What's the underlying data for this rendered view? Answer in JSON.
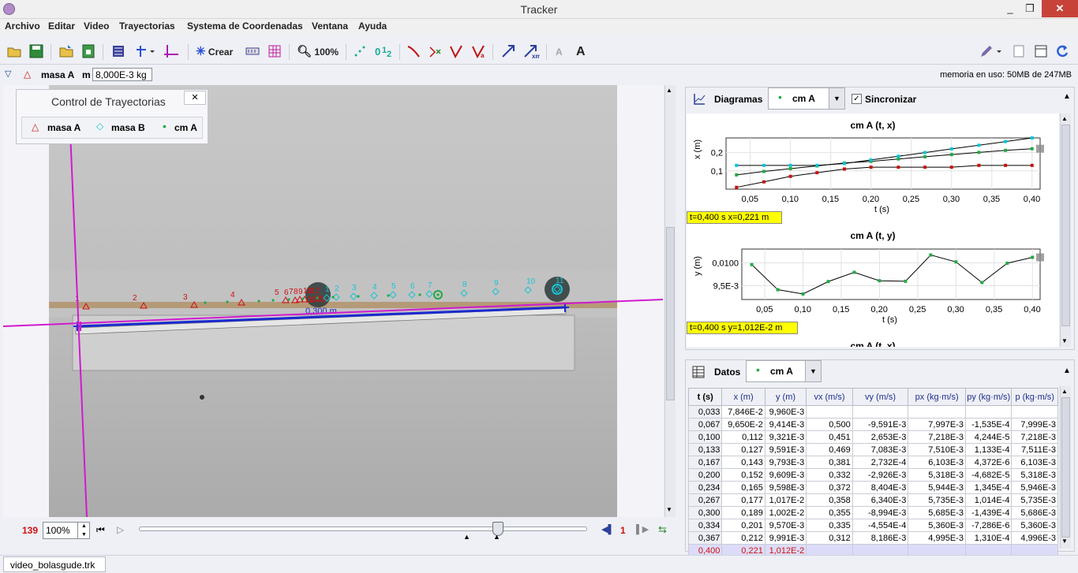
{
  "window": {
    "title": "Tracker",
    "minimize": "_",
    "restore": "❐",
    "close": "✕"
  },
  "menu": [
    "Archivo",
    "Editar",
    "Video",
    "Trayectorias",
    "Systema de Coordenadas",
    "Ventana",
    "Ayuda"
  ],
  "toolbar": {
    "create_label": "Crear",
    "zoom_label": "100%",
    "font_small": "A",
    "font_large": "A"
  },
  "trackbar": {
    "track_name": "masa A",
    "mass_label": "m",
    "mass_value": "8,000E-3 kg",
    "memory": "memoria en uso: 50MB de 247MB"
  },
  "track_control": {
    "title": "Control de Trayectorias",
    "close": "✕",
    "tracks": [
      "masa A",
      "masa B",
      "cm A"
    ]
  },
  "video": {
    "distance_label": "0,300 m",
    "marks_a": [
      "1",
      "2",
      "3",
      "4",
      "5",
      "6",
      "7",
      "8",
      "9",
      "10",
      "11",
      "12"
    ],
    "marks_b": [
      "1",
      "2",
      "3",
      "4",
      "5",
      "6",
      "7",
      "8",
      "9",
      "10",
      "11",
      "12"
    ]
  },
  "playback": {
    "frame_count": "139",
    "zoom": "100%",
    "step": "1"
  },
  "plots": {
    "panel_label": "Diagramas",
    "track": "cm A",
    "sync_label": "Sincronizar",
    "plot1": {
      "title": "cm A (t, x)",
      "ylabel": "x (m)",
      "xlabel": "t (s)",
      "readout": "t=0,400 s  x=0,221 m"
    },
    "plot2": {
      "title": "cm A (t, y)",
      "ylabel": "y (m)",
      "xlabel": "t (s)",
      "readout": "t=0,400 s  y=1,012E-2 m"
    },
    "plot3_title": "cm A (t, x)"
  },
  "chart_data": [
    {
      "type": "scatter",
      "title": "cm A (t, x)",
      "xlabel": "t (s)",
      "ylabel": "x (m)",
      "xticks": [
        "0,05",
        "0,10",
        "0,15",
        "0,20",
        "0,25",
        "0,30",
        "0,35",
        "0,40"
      ],
      "yticks": [
        "0,1",
        "0,2"
      ],
      "xlim": [
        0.02,
        0.41
      ],
      "ylim": [
        0.0,
        0.28
      ],
      "series": [
        {
          "name": "cm A",
          "color": "#22aa44",
          "x": [
            0.033,
            0.067,
            0.1,
            0.133,
            0.167,
            0.2,
            0.234,
            0.267,
            0.3,
            0.334,
            0.367,
            0.4
          ],
          "y": [
            0.078,
            0.097,
            0.112,
            0.127,
            0.143,
            0.152,
            0.165,
            0.177,
            0.189,
            0.201,
            0.212,
            0.221
          ]
        },
        {
          "name": "masa B",
          "color": "#00c8d8",
          "x": [
            0.033,
            0.067,
            0.1,
            0.133,
            0.167,
            0.2,
            0.234,
            0.267,
            0.3,
            0.334,
            0.367,
            0.4
          ],
          "y": [
            0.13,
            0.13,
            0.13,
            0.13,
            0.14,
            0.16,
            0.18,
            0.2,
            0.22,
            0.24,
            0.26,
            0.28
          ]
        },
        {
          "name": "masa A",
          "color": "#cc1010",
          "x": [
            0.033,
            0.067,
            0.1,
            0.133,
            0.167,
            0.2,
            0.234,
            0.267,
            0.3,
            0.334,
            0.367,
            0.4
          ],
          "y": [
            0.01,
            0.04,
            0.07,
            0.09,
            0.11,
            0.12,
            0.12,
            0.12,
            0.12,
            0.13,
            0.13,
            0.13
          ]
        }
      ]
    },
    {
      "type": "line",
      "title": "cm A (t, y)",
      "xlabel": "t (s)",
      "ylabel": "y (m)",
      "xticks": [
        "0,05",
        "0,10",
        "0,15",
        "0,20",
        "0,25",
        "0,30",
        "0,35",
        "0,40"
      ],
      "yticks": [
        "9,5E-3",
        "0,0100"
      ],
      "xlim": [
        0.02,
        0.41
      ],
      "ylim": [
        0.0092,
        0.0103
      ],
      "series": [
        {
          "name": "cm A",
          "color": "#22aa44",
          "x": [
            0.033,
            0.067,
            0.1,
            0.133,
            0.167,
            0.2,
            0.234,
            0.267,
            0.3,
            0.334,
            0.367,
            0.4
          ],
          "y": [
            0.00996,
            0.009414,
            0.009321,
            0.009591,
            0.009793,
            0.009609,
            0.009598,
            0.01017,
            0.01002,
            0.00957,
            0.009991,
            0.01012
          ]
        }
      ]
    }
  ],
  "datos": {
    "panel_label": "Datos",
    "track": "cm A",
    "headers": [
      "t (s)",
      "x (m)",
      "y (m)",
      "vx (m/s)",
      "vy (m/s)",
      "px (kg·m/s)",
      "py (kg·m/s)",
      "p (kg·m/s)"
    ],
    "rows": [
      [
        "0,033",
        "7,846E-2",
        "9,960E-3",
        "",
        "",
        "",
        "",
        ""
      ],
      [
        "0,067",
        "9,650E-2",
        "9,414E-3",
        "0,500",
        "-9,591E-3",
        "7,997E-3",
        "-1,535E-4",
        "7,999E-3"
      ],
      [
        "0,100",
        "0,112",
        "9,321E-3",
        "0,451",
        "2,653E-3",
        "7,218E-3",
        "4,244E-5",
        "7,218E-3"
      ],
      [
        "0,133",
        "0,127",
        "9,591E-3",
        "0,469",
        "7,083E-3",
        "7,510E-3",
        "1,133E-4",
        "7,511E-3"
      ],
      [
        "0,167",
        "0,143",
        "9,793E-3",
        "0,381",
        "2,732E-4",
        "6,103E-3",
        "4,372E-6",
        "6,103E-3"
      ],
      [
        "0,200",
        "0,152",
        "9,609E-3",
        "0,332",
        "-2,926E-3",
        "5,318E-3",
        "-4,682E-5",
        "5,318E-3"
      ],
      [
        "0,234",
        "0,165",
        "9,598E-3",
        "0,372",
        "8,404E-3",
        "5,944E-3",
        "1,345E-4",
        "5,946E-3"
      ],
      [
        "0,267",
        "0,177",
        "1,017E-2",
        "0,358",
        "6,340E-3",
        "5,735E-3",
        "1,014E-4",
        "5,735E-3"
      ],
      [
        "0,300",
        "0,189",
        "1,002E-2",
        "0,355",
        "-8,994E-3",
        "5,685E-3",
        "-1,439E-4",
        "5,686E-3"
      ],
      [
        "0,334",
        "0,201",
        "9,570E-3",
        "0,335",
        "-4,554E-4",
        "5,360E-3",
        "-7,286E-6",
        "5,360E-3"
      ],
      [
        "0,367",
        "0,212",
        "9,991E-3",
        "0,312",
        "8,186E-3",
        "4,995E-3",
        "1,310E-4",
        "4,996E-3"
      ],
      [
        "0,400",
        "0,221",
        "1,012E-2",
        "",
        "",
        "",
        "",
        ""
      ]
    ]
  },
  "tabs": {
    "file": "video_bolasgude.trk"
  }
}
